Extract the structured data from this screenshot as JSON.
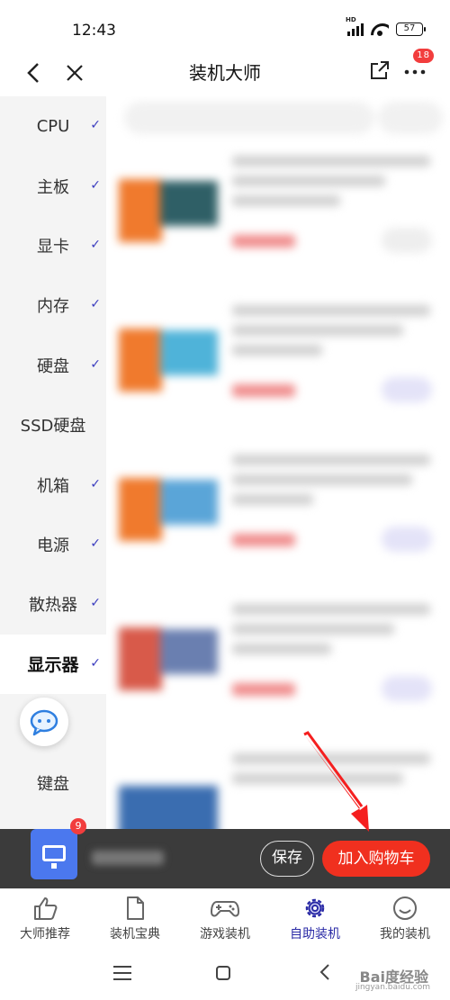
{
  "status_bar": {
    "time": "12:43",
    "network": "HD",
    "battery": "57"
  },
  "header": {
    "title": "装机大师",
    "more_badge": "18"
  },
  "sidebar": {
    "items": [
      {
        "label": "CPU",
        "checked": true,
        "active": false
      },
      {
        "label": "主板",
        "checked": true,
        "active": false
      },
      {
        "label": "显卡",
        "checked": true,
        "active": false
      },
      {
        "label": "内存",
        "checked": true,
        "active": false
      },
      {
        "label": "硬盘",
        "checked": true,
        "active": false
      },
      {
        "label": "SSD硬盘",
        "checked": false,
        "active": false
      },
      {
        "label": "机箱",
        "checked": true,
        "active": false
      },
      {
        "label": "电源",
        "checked": true,
        "active": false
      },
      {
        "label": "散热器",
        "checked": true,
        "active": false
      },
      {
        "label": "显示器",
        "checked": true,
        "active": true
      },
      {
        "label": "",
        "checked": false,
        "active": false
      },
      {
        "label": "键盘",
        "checked": false,
        "active": false
      }
    ],
    "check_mark": "✓"
  },
  "cart_bar": {
    "badge": "9",
    "save_label": "保存",
    "add_to_cart_label": "加入购物车"
  },
  "tabs": [
    {
      "label": "大师推荐",
      "icon": "thumbs-up-icon",
      "active": false
    },
    {
      "label": "装机宝典",
      "icon": "document-icon",
      "active": false
    },
    {
      "label": "游戏装机",
      "icon": "gamepad-icon",
      "active": false
    },
    {
      "label": "自助装机",
      "icon": "gear-icon",
      "active": true
    },
    {
      "label": "我的装机",
      "icon": "smiley-icon",
      "active": false
    }
  ],
  "watermark": {
    "text": "Bai度经验",
    "sub": "jingyan.baidu.com"
  },
  "colors": {
    "accent": "#2a2aa6",
    "cart_button": "#f0301f",
    "badge": "#f23d3d",
    "cart_bar": "#3b3b3b"
  }
}
